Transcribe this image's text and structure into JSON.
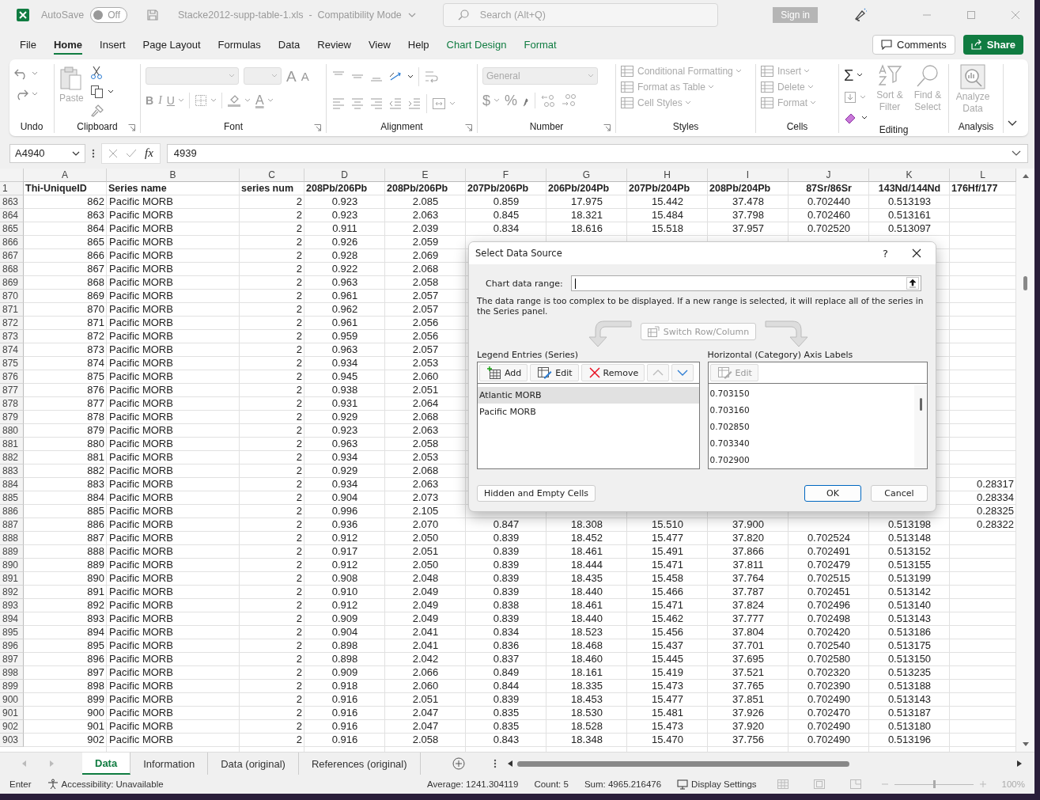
{
  "title_bar": {
    "autosave": {
      "label": "AutoSave",
      "on": false,
      "state": "Off"
    },
    "document": "Stacke2012-supp-table-1.xls  -  Compatibility Mode",
    "search": {
      "placeholder": "Search (Alt+Q)"
    },
    "sign_in": "Sign in"
  },
  "menu": {
    "tabs": [
      {
        "label": "File",
        "selected": false,
        "kind": "normal"
      },
      {
        "label": "Home",
        "selected": true,
        "kind": "normal"
      },
      {
        "label": "Insert",
        "selected": false,
        "kind": "normal"
      },
      {
        "label": "Page Layout",
        "selected": false,
        "kind": "normal"
      },
      {
        "label": "Formulas",
        "selected": false,
        "kind": "normal"
      },
      {
        "label": "Data",
        "selected": false,
        "kind": "normal"
      },
      {
        "label": "Review",
        "selected": false,
        "kind": "normal"
      },
      {
        "label": "View",
        "selected": false,
        "kind": "normal"
      },
      {
        "label": "Help",
        "selected": false,
        "kind": "normal"
      },
      {
        "label": "Chart Design",
        "selected": false,
        "kind": "contextual"
      },
      {
        "label": "Format",
        "selected": false,
        "kind": "contextual"
      }
    ],
    "comments": "Comments",
    "share": "Share"
  },
  "ribbon": {
    "groups": [
      {
        "kind": "undo",
        "label": "Undo"
      },
      {
        "kind": "clipboard",
        "label": "Clipboard",
        "paste": "Paste"
      },
      {
        "kind": "font",
        "label": "Font",
        "size_buttons": [
          "A",
          "A"
        ],
        "style_buttons": [
          "B",
          "I",
          "U"
        ],
        "font_color": "A"
      },
      {
        "kind": "alignment",
        "label": "Alignment"
      },
      {
        "kind": "number",
        "label": "Number",
        "format": "General",
        "symbols": [
          "$",
          "%"
        ]
      },
      {
        "kind": "styles",
        "label": "Styles",
        "items": [
          "Conditional Formatting",
          "Format as Table",
          "Cell Styles"
        ]
      },
      {
        "kind": "cells",
        "label": "Cells",
        "items": [
          "Insert",
          "Delete",
          "Format"
        ]
      },
      {
        "kind": "editing",
        "label": "Editing",
        "sum": "Σ",
        "items": [
          "Sort & Filter",
          "Find & Select"
        ]
      },
      {
        "kind": "analysis",
        "label": "Analysis",
        "items": [
          "Analyze Data"
        ]
      }
    ]
  },
  "formula_bar": {
    "name_box": "A4940",
    "fx": "fx",
    "value": "4939"
  },
  "sheet": {
    "columns": [
      "A",
      "B",
      "C",
      "D",
      "E",
      "F",
      "G",
      "H",
      "I",
      "J",
      "K",
      "L"
    ],
    "header_row": {
      "num": "1",
      "cells": [
        "Thi-UniqueID",
        "Series name",
        "series num",
        "208Pb/206Pb",
        "208Pb/206Pb",
        "207Pb/206Pb",
        "206Pb/204Pb",
        "207Pb/204Pb",
        "208Pb/204Pb",
        "87Sr/86Sr",
        "143Nd/144Nd",
        "176Hf/177"
      ]
    },
    "rows": [
      {
        "num": "863",
        "cells": [
          "862",
          "Pacific MORB",
          "2",
          "0.923",
          "2.085",
          "0.859",
          "17.975",
          "15.442",
          "37.478",
          "0.702440",
          "0.513193"
        ]
      },
      {
        "num": "864",
        "cells": [
          "863",
          "Pacific MORB",
          "2",
          "0.923",
          "2.063",
          "0.845",
          "18.321",
          "15.484",
          "37.798",
          "0.702460",
          "0.513161"
        ]
      },
      {
        "num": "865",
        "cells": [
          "864",
          "Pacific MORB",
          "2",
          "0.911",
          "2.039",
          "0.834",
          "18.616",
          "15.518",
          "37.957",
          "0.702520",
          "0.513097"
        ]
      },
      {
        "num": "866",
        "cells": [
          "865",
          "Pacific MORB",
          "2",
          "0.926",
          "2.059"
        ]
      },
      {
        "num": "867",
        "cells": [
          "866",
          "Pacific MORB",
          "2",
          "0.928",
          "2.069"
        ]
      },
      {
        "num": "868",
        "cells": [
          "867",
          "Pacific MORB",
          "2",
          "0.922",
          "2.068"
        ]
      },
      {
        "num": "869",
        "cells": [
          "868",
          "Pacific MORB",
          "2",
          "0.963",
          "2.058"
        ]
      },
      {
        "num": "870",
        "cells": [
          "869",
          "Pacific MORB",
          "2",
          "0.961",
          "2.057"
        ]
      },
      {
        "num": "871",
        "cells": [
          "870",
          "Pacific MORB",
          "2",
          "0.962",
          "2.057"
        ]
      },
      {
        "num": "872",
        "cells": [
          "871",
          "Pacific MORB",
          "2",
          "0.961",
          "2.056"
        ]
      },
      {
        "num": "873",
        "cells": [
          "872",
          "Pacific MORB",
          "2",
          "0.959",
          "2.056"
        ]
      },
      {
        "num": "874",
        "cells": [
          "873",
          "Pacific MORB",
          "2",
          "0.963",
          "2.057"
        ]
      },
      {
        "num": "875",
        "cells": [
          "874",
          "Pacific MORB",
          "2",
          "0.934",
          "2.053"
        ]
      },
      {
        "num": "876",
        "cells": [
          "875",
          "Pacific MORB",
          "2",
          "0.945",
          "2.060"
        ]
      },
      {
        "num": "877",
        "cells": [
          "876",
          "Pacific MORB",
          "2",
          "0.938",
          "2.051"
        ]
      },
      {
        "num": "878",
        "cells": [
          "877",
          "Pacific MORB",
          "2",
          "0.931",
          "2.064"
        ]
      },
      {
        "num": "879",
        "cells": [
          "878",
          "Pacific MORB",
          "2",
          "0.929",
          "2.068"
        ]
      },
      {
        "num": "880",
        "cells": [
          "879",
          "Pacific MORB",
          "2",
          "0.923",
          "2.063"
        ]
      },
      {
        "num": "881",
        "cells": [
          "880",
          "Pacific MORB",
          "2",
          "0.963",
          "2.058"
        ]
      },
      {
        "num": "882",
        "cells": [
          "881",
          "Pacific MORB",
          "2",
          "0.934",
          "2.053"
        ]
      },
      {
        "num": "883",
        "cells": [
          "882",
          "Pacific MORB",
          "2",
          "0.929",
          "2.068"
        ]
      },
      {
        "num": "884",
        "cells": [
          "883",
          "Pacific MORB",
          "2",
          "0.934",
          "2.063",
          null,
          null,
          null,
          null,
          null,
          null,
          "0.28317"
        ]
      },
      {
        "num": "885",
        "cells": [
          "884",
          "Pacific MORB",
          "2",
          "0.904",
          "2.073",
          null,
          null,
          null,
          null,
          null,
          null,
          "0.28334"
        ]
      },
      {
        "num": "886",
        "cells": [
          "885",
          "Pacific MORB",
          "2",
          "0.996",
          "2.105",
          null,
          null,
          null,
          null,
          null,
          null,
          "0.28325"
        ]
      },
      {
        "num": "887",
        "cells": [
          "886",
          "Pacific MORB",
          "2",
          "0.936",
          "2.070",
          "0.847",
          "18.308",
          "15.510",
          "37.900",
          null,
          "0.513198",
          "0.28322"
        ]
      },
      {
        "num": "888",
        "cells": [
          "887",
          "Pacific MORB",
          "2",
          "0.912",
          "2.050",
          "0.839",
          "18.452",
          "15.477",
          "37.820",
          "0.702524",
          "0.513148"
        ]
      },
      {
        "num": "889",
        "cells": [
          "888",
          "Pacific MORB",
          "2",
          "0.917",
          "2.051",
          "0.839",
          "18.461",
          "15.491",
          "37.866",
          "0.702491",
          "0.513152"
        ]
      },
      {
        "num": "890",
        "cells": [
          "889",
          "Pacific MORB",
          "2",
          "0.912",
          "2.050",
          "0.839",
          "18.444",
          "15.471",
          "37.811",
          "0.702479",
          "0.513155"
        ]
      },
      {
        "num": "891",
        "cells": [
          "890",
          "Pacific MORB",
          "2",
          "0.908",
          "2.048",
          "0.839",
          "18.435",
          "15.458",
          "37.764",
          "0.702515",
          "0.513199"
        ]
      },
      {
        "num": "892",
        "cells": [
          "891",
          "Pacific MORB",
          "2",
          "0.910",
          "2.049",
          "0.839",
          "18.440",
          "15.466",
          "37.787",
          "0.702451",
          "0.513142"
        ]
      },
      {
        "num": "893",
        "cells": [
          "892",
          "Pacific MORB",
          "2",
          "0.912",
          "2.049",
          "0.838",
          "18.461",
          "15.471",
          "37.824",
          "0.702496",
          "0.513140"
        ]
      },
      {
        "num": "894",
        "cells": [
          "893",
          "Pacific MORB",
          "2",
          "0.909",
          "2.049",
          "0.839",
          "18.440",
          "15.462",
          "37.777",
          "0.702498",
          "0.513143"
        ]
      },
      {
        "num": "895",
        "cells": [
          "894",
          "Pacific MORB",
          "2",
          "0.904",
          "2.041",
          "0.834",
          "18.523",
          "15.456",
          "37.804",
          "0.702420",
          "0.513186"
        ]
      },
      {
        "num": "896",
        "cells": [
          "895",
          "Pacific MORB",
          "2",
          "0.898",
          "2.041",
          "0.836",
          "18.468",
          "15.437",
          "37.701",
          "0.702540",
          "0.513175"
        ]
      },
      {
        "num": "897",
        "cells": [
          "896",
          "Pacific MORB",
          "2",
          "0.898",
          "2.042",
          "0.837",
          "18.460",
          "15.445",
          "37.695",
          "0.702580",
          "0.513150"
        ]
      },
      {
        "num": "898",
        "cells": [
          "897",
          "Pacific MORB",
          "2",
          "0.909",
          "2.066",
          "0.849",
          "18.161",
          "15.419",
          "37.521",
          "0.702320",
          "0.513235"
        ]
      },
      {
        "num": "899",
        "cells": [
          "898",
          "Pacific MORB",
          "2",
          "0.918",
          "2.060",
          "0.844",
          "18.335",
          "15.473",
          "37.765",
          "0.702390",
          "0.513188"
        ]
      },
      {
        "num": "900",
        "cells": [
          "899",
          "Pacific MORB",
          "2",
          "0.916",
          "2.051",
          "0.839",
          "18.453",
          "15.477",
          "37.851",
          "0.702490",
          "0.513143"
        ]
      },
      {
        "num": "901",
        "cells": [
          "900",
          "Pacific MORB",
          "2",
          "0.916",
          "2.047",
          "0.835",
          "18.530",
          "15.481",
          "37.926",
          "0.702470",
          "0.513187"
        ]
      },
      {
        "num": "902",
        "cells": [
          "901",
          "Pacific MORB",
          "2",
          "0.916",
          "2.047",
          "0.835",
          "18.528",
          "15.473",
          "37.920",
          "0.702490",
          "0.513180"
        ]
      },
      {
        "num": "903",
        "cells": [
          "902",
          "Pacific MORB",
          "2",
          "0.916",
          "2.058",
          "0.843",
          "18.348",
          "15.470",
          "37.756",
          "0.702490",
          "0.513196"
        ]
      }
    ]
  },
  "dialog": {
    "title": "Select Data Source",
    "help": "?",
    "range": {
      "label": "Chart data range:"
    },
    "message": "The data range is too complex to be displayed. If a new range is selected, it will replace all of the series in the Series panel.",
    "switch_button": {
      "label": "Switch Row/Column",
      "disabled": true
    },
    "legend": {
      "label": "Legend Entries (Series)",
      "buttons": [
        {
          "label": "Add",
          "kind": "add",
          "disabled": false
        },
        {
          "label": "Edit",
          "kind": "edit",
          "disabled": false
        },
        {
          "label": "Remove",
          "kind": "remove",
          "disabled": false
        }
      ],
      "move_buttons": [
        {
          "kind": "up",
          "disabled": true
        },
        {
          "kind": "down",
          "disabled": false
        }
      ],
      "series": [
        {
          "label": "Atlantic MORB",
          "selected": true
        },
        {
          "label": "Pacific MORB",
          "selected": false
        }
      ]
    },
    "axis": {
      "label": "Horizontal (Category) Axis Labels",
      "edit": {
        "label": "Edit",
        "disabled": true
      },
      "values": [
        "0.703150",
        "0.703160",
        "0.702850",
        "0.703340",
        "0.702900"
      ]
    },
    "hidden_cells": "Hidden and Empty Cells",
    "ok": "OK",
    "cancel": "Cancel"
  },
  "sheet_tabs": [
    {
      "label": "Data",
      "selected": true
    },
    {
      "label": "Information",
      "selected": false
    },
    {
      "label": "Data (original)",
      "selected": false
    },
    {
      "label": "References (original)",
      "selected": false
    }
  ],
  "status_bar": {
    "mode": "Enter",
    "accessibility": "Accessibility: Unavailable",
    "average": "Average: 1241.304119",
    "count": "Count: 5",
    "sum": "Sum: 4965.216476",
    "display_settings": "Display Settings",
    "zoom": {
      "level": 0.5,
      "reading": "100%"
    }
  }
}
